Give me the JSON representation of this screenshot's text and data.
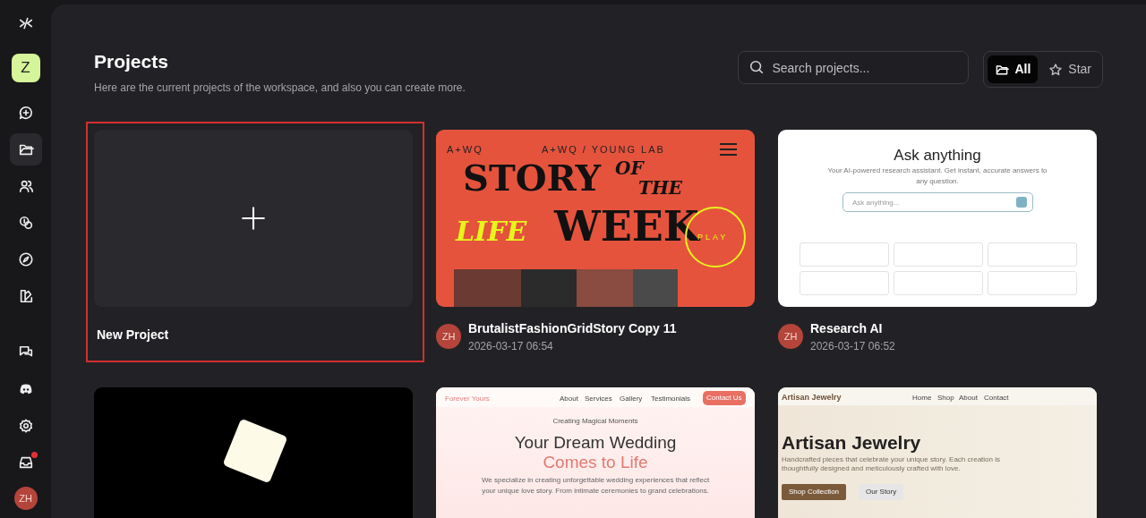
{
  "sidebar": {
    "workspace_avatar": "Z",
    "nav_items": [
      {
        "selected": false
      },
      {
        "selected": true
      },
      {
        "selected": false
      },
      {
        "selected": false
      },
      {
        "selected": false
      },
      {
        "selected": false
      }
    ],
    "bottom_items": [
      {
        "unread": false
      },
      {
        "unread": false
      },
      {
        "unread": false
      },
      {
        "unread": true
      }
    ],
    "user_avatar": "ZH"
  },
  "header": {
    "title": "Projects",
    "subtitle": "Here are the current projects of the workspace, and also you can create more.",
    "search": {
      "placeholder": "Search projects..."
    },
    "filters": [
      {
        "label": "All",
        "selected": true
      },
      {
        "label": "Star",
        "selected": false
      }
    ]
  },
  "projects": [
    {
      "kind": "new",
      "title": "New Project",
      "selected": true
    },
    {
      "kind": "brutalist",
      "title": "BrutalistFashionGridStory Copy 11",
      "date": "2026-03-17 06:54",
      "owner": "ZH",
      "selected": false,
      "preview_texts": [
        "A+WQ",
        "A+WQ / YOUNG LAB",
        "STORY",
        "OF",
        "THE",
        "LIFE",
        "WEEK",
        "PLAY"
      ]
    },
    {
      "kind": "research",
      "title": "Research AI",
      "date": "2026-03-17 06:52",
      "owner": "ZH",
      "selected": false,
      "preview_texts": [
        "Ask anything",
        "Your AI-powered research assistant. Get instant, accurate answers to any question.",
        "Ask anything..."
      ]
    },
    {
      "kind": "cube",
      "selected": false
    },
    {
      "kind": "wedding",
      "selected": false,
      "preview_texts": [
        "Forever Yours",
        "About",
        "Services",
        "Gallery",
        "Testimonials",
        "Contact Us",
        "Creating Magical Moments",
        "Your Dream Wedding",
        "Comes to Life",
        "We specialize in creating unforgettable wedding experiences that reflect your unique love story. From intimate ceremonies to grand celebrations."
      ]
    },
    {
      "kind": "jewelry",
      "selected": false,
      "preview_texts": [
        "Artisan Jewelry",
        "Home",
        "Shop",
        "About",
        "Contact",
        "Artisan Jewelry",
        "Handcrafted pieces that celebrate your unique story. Each creation is thoughtfully designed and meticulously crafted with love.",
        "Shop Collection",
        "Our Story"
      ]
    }
  ]
}
